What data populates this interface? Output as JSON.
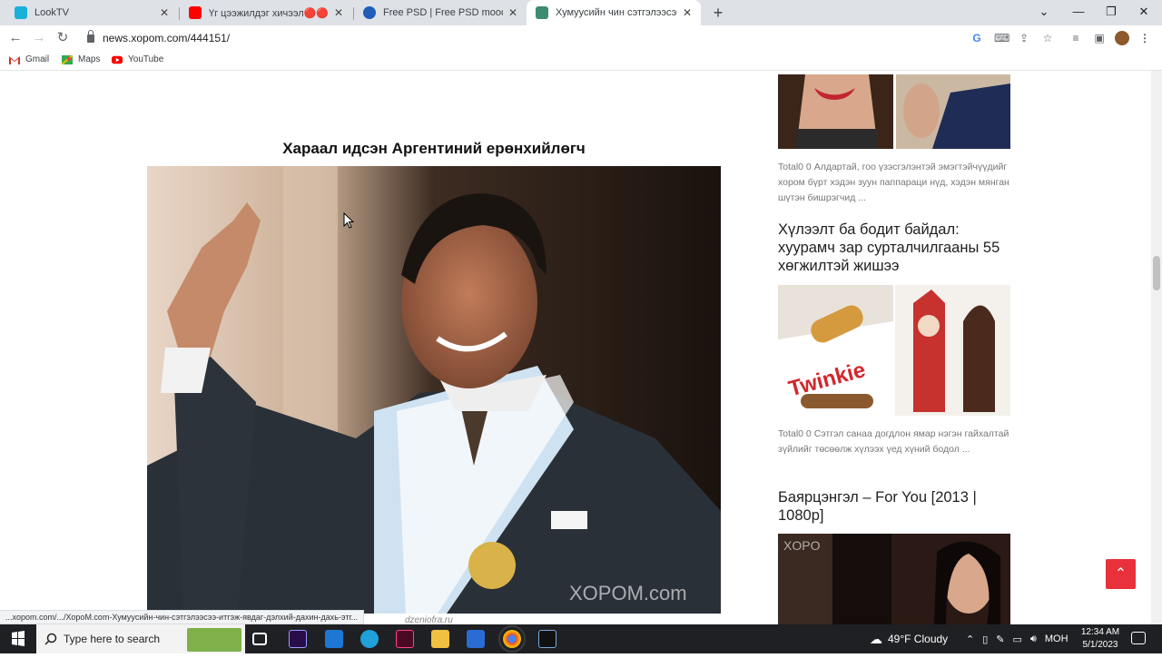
{
  "browser": {
    "tabs": [
      {
        "title": "LookTV",
        "active": false,
        "favicon_color": "#1ab0d8"
      },
      {
        "title": "Үг цээжилдэг хичээл🔴🔴🔴 -",
        "active": false,
        "favicon_color": "#ff0000"
      },
      {
        "title": "Free PSD | Free PSD moody food",
        "active": false,
        "favicon_color": "#1f5db8"
      },
      {
        "title": "Хумуусийн чин сэтгэлээсээ итгэ",
        "active": true,
        "favicon_color": "#3e8c6f"
      }
    ],
    "new_tab": "+",
    "window_controls": {
      "dropdown": "⌄",
      "minimize": "—",
      "restore": "❐",
      "close": "✕"
    },
    "address": "news.xopom.com/444151/",
    "bookmarks": [
      {
        "label": "Gmail",
        "icon": "gmail-icon",
        "color": "#d93025"
      },
      {
        "label": "Maps",
        "icon": "maps-icon",
        "color": "#34a853"
      },
      {
        "label": "YouTube",
        "icon": "youtube-icon",
        "color": "#ff0000"
      }
    ]
  },
  "article": {
    "headline": "Хараал идсэн Аргентиний ерөнхийлөгч",
    "photo_credit": "dzeniofra.ru",
    "watermark": "XOPOM.com"
  },
  "sidebar": {
    "snippet1": "Total0 0 Алдартай, гоо үзэсгэлэнтэй эмэгтэйчүүдийг хором бүрт хэдэн зуун паппараци нүд, хэдэн мянган шүтэн бишрэгчид ...",
    "title2": "Хүлээлт ба бодит байдал: хуурамч зар сурталчилгааны 55 хөгжилтэй жишээ",
    "snippet2": "Total0 0 Сэтгэл санаа догдлон ямар нэгэн гайхалтай зүйлийг төсөөлж хүлээх үед хүний бодол ...",
    "title3": "Баярцэнгэл – For You [2013 | 1080p]",
    "img2_label": "Twinkie",
    "img3_watermark": "XOPO"
  },
  "status_url": "...xopom.com/.../ХороМ.com-Хумуусийн-чин-сэтгэлээсээ-итгэж-явдаг-дэлхий-дахин-дахь-этг...",
  "taskbar": {
    "search_placeholder": "Type here to search",
    "weather": "49°F  Cloudy",
    "language": "МОН",
    "time": "12:34 AM",
    "date": "5/1/2023"
  }
}
